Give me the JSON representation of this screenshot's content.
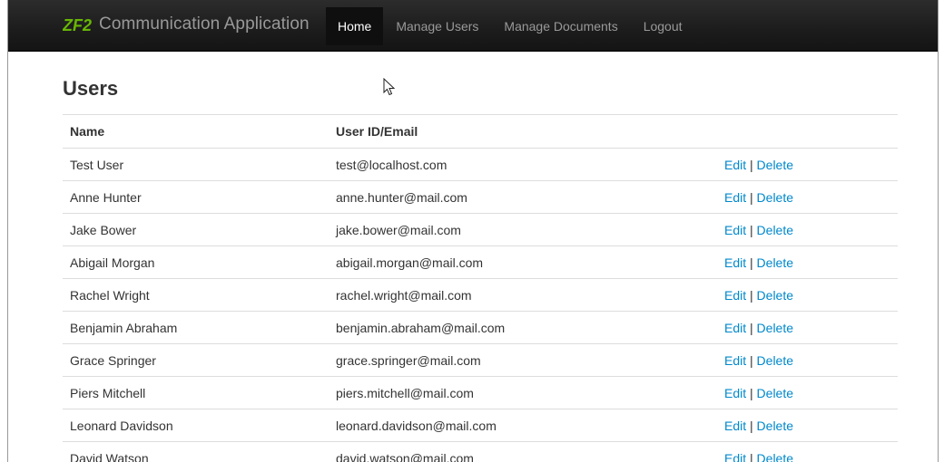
{
  "navbar": {
    "brand_logo": "ZF2",
    "brand": "Communication Application",
    "items": [
      {
        "label": "Home",
        "active": true
      },
      {
        "label": "Manage Users",
        "active": false
      },
      {
        "label": "Manage Documents",
        "active": false
      },
      {
        "label": "Logout",
        "active": false
      }
    ]
  },
  "page": {
    "title": "Users"
  },
  "table": {
    "headers": [
      "Name",
      "User ID/Email",
      ""
    ],
    "edit_label": "Edit",
    "separator": "|",
    "delete_label": "Delete",
    "rows": [
      {
        "name": "Test User",
        "email": "test@localhost.com"
      },
      {
        "name": "Anne Hunter",
        "email": "anne.hunter@mail.com"
      },
      {
        "name": "Jake Bower",
        "email": "jake.bower@mail.com"
      },
      {
        "name": "Abigail Morgan",
        "email": "abigail.morgan@mail.com"
      },
      {
        "name": "Rachel Wright",
        "email": "rachel.wright@mail.com"
      },
      {
        "name": "Benjamin Abraham",
        "email": "benjamin.abraham@mail.com"
      },
      {
        "name": "Grace Springer",
        "email": "grace.springer@mail.com"
      },
      {
        "name": "Piers Mitchell",
        "email": "piers.mitchell@mail.com"
      },
      {
        "name": "Leonard Davidson",
        "email": "leonard.davidson@mail.com"
      },
      {
        "name": "David Watson",
        "email": "david.watson@mail.com"
      }
    ]
  },
  "colors": {
    "navbar_bg": "#1c1c1c",
    "nav_text": "#999999",
    "nav_active_text": "#ffffff",
    "link": "#0088cc",
    "logo_green": "#68b604"
  },
  "icons": {
    "cursor": "mouse-pointer-icon"
  }
}
